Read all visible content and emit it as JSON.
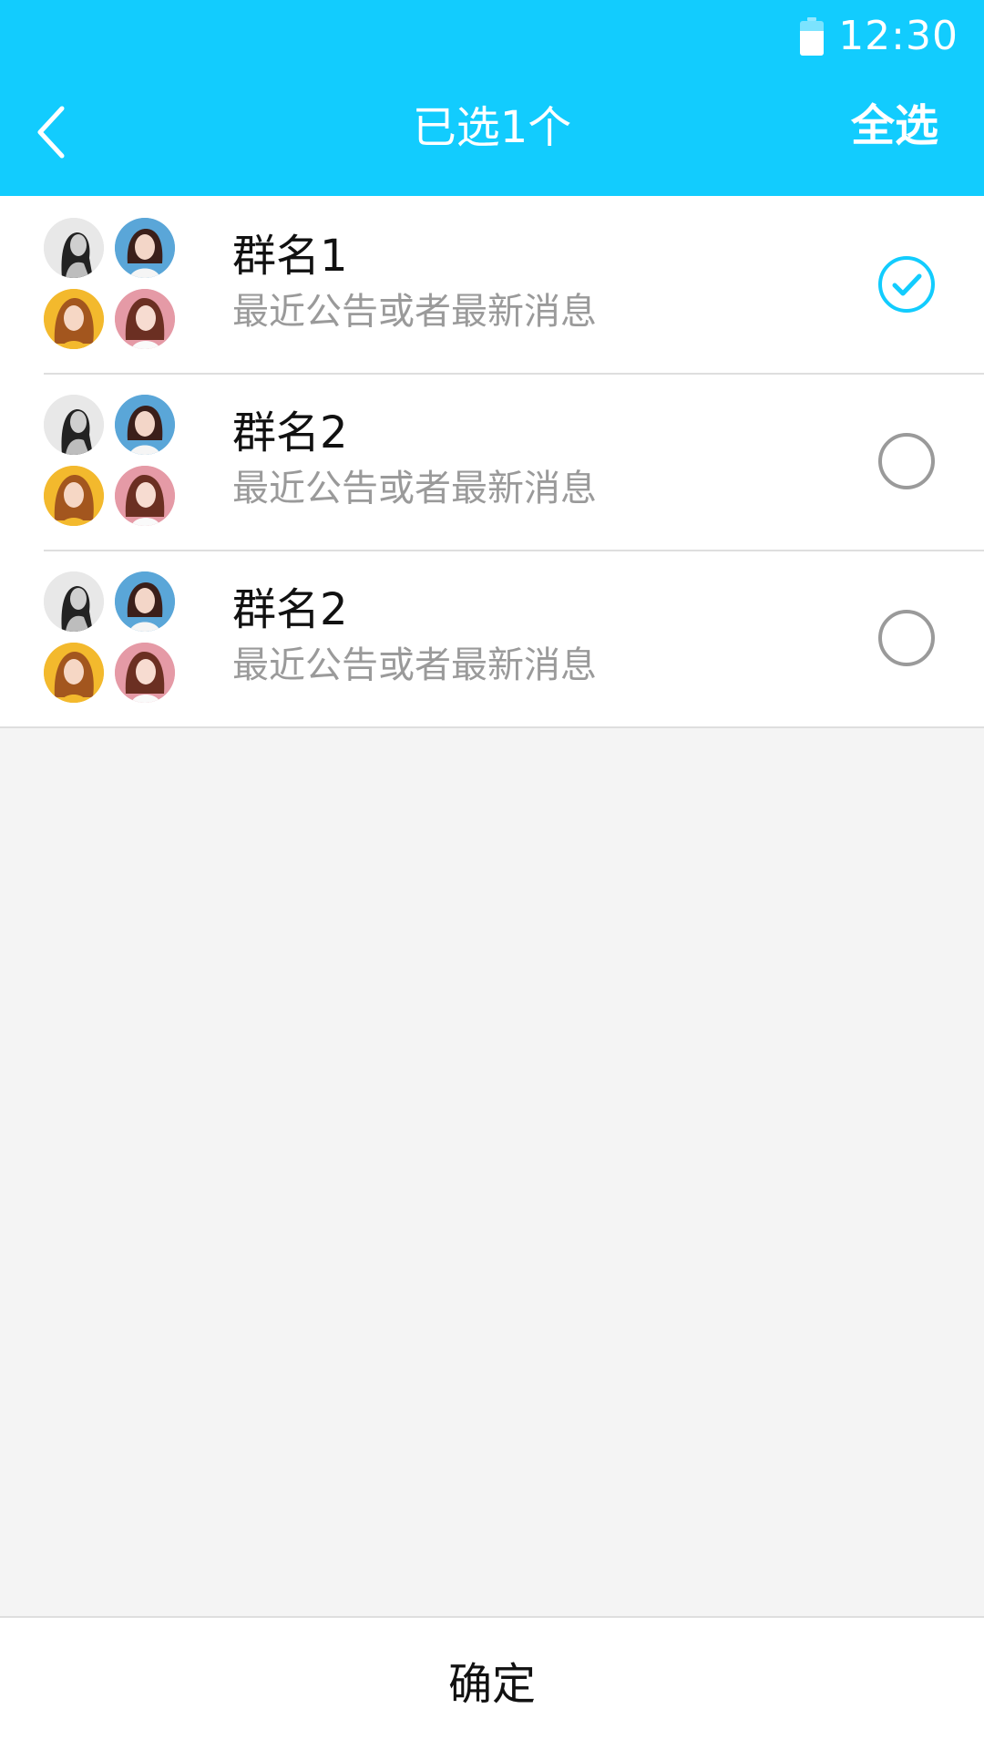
{
  "status_bar": {
    "time": "12:30",
    "battery_level": 0.7,
    "battery_icon": "battery-icon"
  },
  "header": {
    "back_icon": "chevron-left-icon",
    "title": "已选1个",
    "select_all_label": "全选",
    "background_color": "#12ccfe"
  },
  "groups": [
    {
      "name": "群名1",
      "message": "最近公告或者最新消息",
      "selected": true
    },
    {
      "name": "群名2",
      "message": "最近公告或者最新消息",
      "selected": false
    },
    {
      "name": "群名2",
      "message": "最近公告或者最新消息",
      "selected": false
    }
  ],
  "footer": {
    "confirm_label": "确定"
  },
  "colors": {
    "accent": "#12ccfe",
    "unchecked": "#9a9a9a",
    "secondary_text": "#9a9a9a",
    "divider": "#dedede"
  }
}
